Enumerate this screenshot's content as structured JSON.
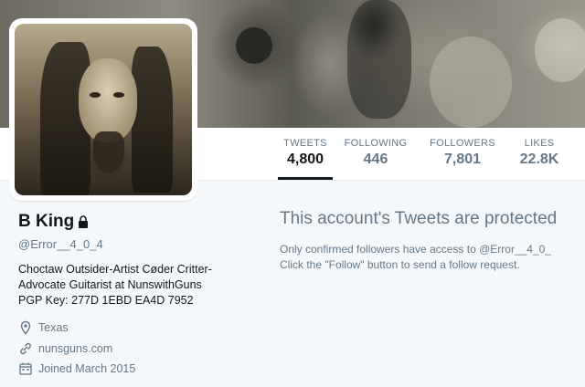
{
  "profile": {
    "name": "B King",
    "handle": "@Error__4_0_4",
    "bio_lines": [
      "Choctaw Outsider-Artist Cøder Critter-",
      "Advocate Guitarist at NunswithGuns",
      "PGP Key: 277D 1EBD EA4D 7952"
    ],
    "location": "Texas",
    "website": "nunsguns.com",
    "joined": "Joined March 2015"
  },
  "stats": [
    {
      "label": "TWEETS",
      "value": "4,800"
    },
    {
      "label": "FOLLOWING",
      "value": "446"
    },
    {
      "label": "FOLLOWERS",
      "value": "7,801"
    },
    {
      "label": "LIKES",
      "value": "22.8K"
    }
  ],
  "protected": {
    "title": "This account's Tweets are protected",
    "line1": "Only confirmed followers have access to @Error__4_0_",
    "line2": "Click the \"Follow\" button to send a follow request."
  },
  "colors": {
    "text_primary": "#14171a",
    "text_secondary": "#657786",
    "background": "#f5f8fa"
  }
}
